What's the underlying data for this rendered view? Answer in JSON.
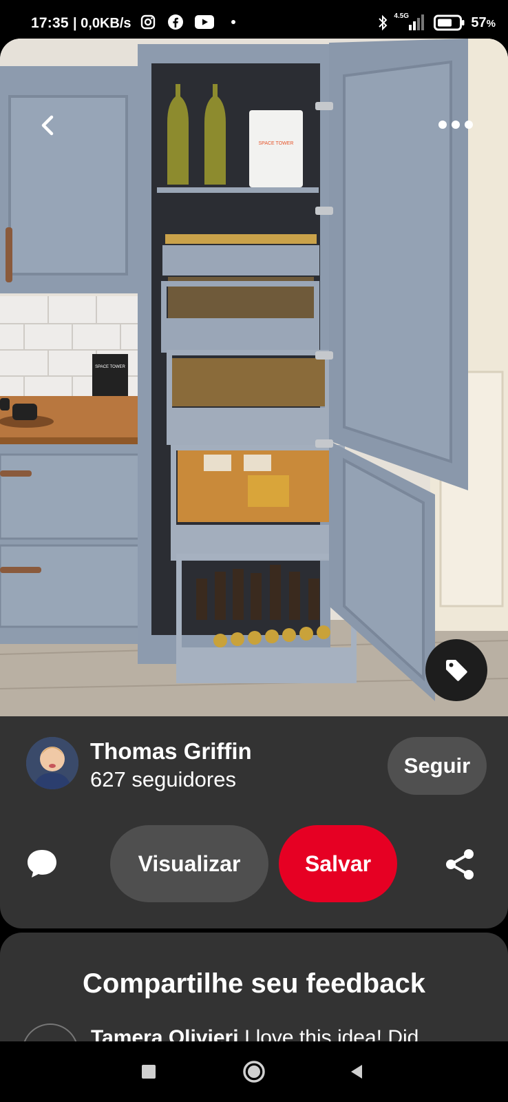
{
  "status_bar": {
    "time": "17:35",
    "network_speed": "| 0,0KB/s",
    "network_type": "4.5G",
    "battery": "57",
    "battery_unit": "%",
    "icons": [
      "instagram-icon",
      "facebook-icon",
      "youtube-icon",
      "dot-icon",
      "bluetooth-icon",
      "signal-icon",
      "battery-icon"
    ]
  },
  "pin": {
    "image_alt": "Grey kitchen pantry cabinet with pull-out drawers",
    "box_label": "SPACE TOWER",
    "sign_label": "SPACE TOWER"
  },
  "author": {
    "name": "Thomas Griffin",
    "followers": "627 seguidores",
    "follow_label": "Seguir"
  },
  "actions": {
    "view_label": "Visualizar",
    "save_label": "Salvar"
  },
  "feedback": {
    "title": "Compartilhe seu feedback",
    "comment_author": "Tamera Olivieri",
    "comment_text": " I love this idea! Did"
  },
  "colors": {
    "save_red": "#e60023",
    "panel_bg": "#333333",
    "button_grey": "#505050"
  }
}
